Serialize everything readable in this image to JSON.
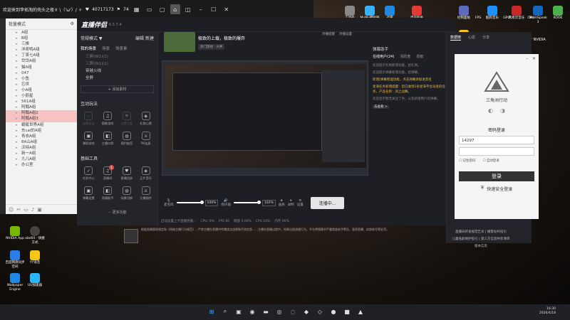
{
  "topbar": {
    "title": "欢迎来到李拓淘的壳头之夜ㅎ \\（'ω'）/ ＋",
    "viewers": "40717173",
    "fans": "74"
  },
  "leftpanel": {
    "mode": "批量模式",
    "items": [
      "A组",
      "B组",
      "三推",
      "洋奇鸭A组",
      "丁某七A组",
      "岱岱A组",
      "猫A组",
      "047",
      "小鱼",
      "忘世",
      "小A组",
      "小朋星",
      "561A组",
      "阿瓢A组",
      "阿瓢A组2",
      "阿瓢A组3",
      "蜻蜓世界A组",
      "东cal的A组",
      "青衣A组",
      "8A山A组",
      "沃特A组",
      "新一A组",
      "九儿A组",
      "办公室"
    ],
    "highlight": [
      14,
      15
    ]
  },
  "app": {
    "name": "直播伴侣",
    "version": "6.5.7.4",
    "scene_section": "常规模式 ▼",
    "scene_edit": "编辑",
    "scene_new": "新建",
    "tabs": [
      "我的场景",
      "场景",
      "场景素"
    ],
    "scenes": [
      "三屏(W1)(2)",
      "三屏(W1)(2)",
      "穿越火线",
      "全屏"
    ],
    "add_source": "+ 添加素材",
    "interact_title": "互动玩法",
    "interact": [
      "投票玩法",
      "猜歌游戏",
      "点赞之星",
      "礼物心愿",
      "弹屏游戏",
      "主播口袋",
      "福利抽签",
      "PK连麦"
    ],
    "tools_title": "基础工具",
    "tools": [
      "任务中心",
      "直播间",
      "直播回放",
      "正片音乐",
      "弹幕设置",
      "直播助手",
      "场景切换",
      "万播插件"
    ],
    "tools_badge": "1",
    "more": "··· 更多功能",
    "stream_title": "极致的上载，极致的爆弃",
    "stream_tags": [
      "热门游戏 · 大神"
    ],
    "top_buttons": [
      "开播提醒",
      "开播设置"
    ],
    "mic_label": "麦克风",
    "mic_pct": "100%",
    "speaker_label": "扬声器",
    "speaker_pct": "102%",
    "ctrl_icons": [
      "画质",
      "录制",
      "设置"
    ],
    "live_btn": "连播中...",
    "status": [
      "启动设置上卡直播热播…",
      "CPU: 0%",
      "FPS 60",
      "网速 0.00%",
      "CPU 10%",
      "内存 80%"
    ],
    "right_tabs": [
      "数据榜",
      "心愿",
      "分享"
    ],
    "danmu_title": "弹幕助手",
    "danmu_tabs": [
      "在线用户(24)",
      "活跃度",
      "贡献"
    ],
    "danmu_msgs": [
      {
        "t": "欢迎提示礼物新增功能，招礼物。",
        "y": false
      },
      {
        "t": "欢迎提示弹幕新增功能，招弹幕。",
        "y": false
      },
      {
        "t": "新增[弹幕管理功能，点击弹幕添加进黑名",
        "y": true
      },
      {
        "t": "星海任务新增提醒：您已收到1条星海平台派发的任务，产品名称：风之战舞。",
        "y": true
      },
      {
        "t": "欢迎显示暂无关注了你，以及新增用户的弹幕。",
        "y": false
      }
    ],
    "danmu_link": "去查看 >"
  },
  "login": {
    "brand": "三角洲行动",
    "pwd_label": "密码登录",
    "account": "14297",
    "remember": "记住密码",
    "autologin": "自动登录",
    "login_btn": "登录",
    "safe_login": "快速安全登录"
  },
  "nvidia": {
    "text": "点击 Alt+Z，打开 NVIDIA 叠加层"
  },
  "tray_icons": [
    {
      "label": "工具栏"
    },
    {
      "label": "MuMu模拟器"
    },
    {
      "label": "迅雷"
    },
    {
      "label": "电竞助手"
    },
    {
      "label": "控制面板"
    },
    {
      "label": "FPS"
    },
    {
      "label": "酷狗音乐"
    },
    {
      "label": "GPU"
    },
    {
      "label": "网易云音乐"
    },
    {
      "label": "CPU"
    },
    {
      "label": "TeamSpeak 3"
    },
    {
      "label": "KOOK"
    },
    {
      "label": "YY开播"
    }
  ],
  "desktop_icons": [
    {
      "label": "NVIDIA App"
    },
    {
      "label": "obs64 - 快捷方式"
    },
    {
      "label": "百度网盘同步空间"
    },
    {
      "label": "YY语音"
    },
    {
      "label": "Wallpaper Engine"
    },
    {
      "label": "UU加速器"
    }
  ],
  "notice": "根据直播管理规定和《网络主播行为规范》，严禁主播在直播中传播违法违规和不良信息……主播在直播过程中，如果出现违规行为，平台将视情节严重程度给予警告、暂停直播、封禁账号等处罚。",
  "right_notice": [
    "直播间开发规范告诉 | 播客标杆指引",
    "儿童低龄保护指引 | 第三方信息共享清单",
    "版本信息"
  ],
  "clock": {
    "time": "16:30",
    "date": "2026/4/18"
  }
}
